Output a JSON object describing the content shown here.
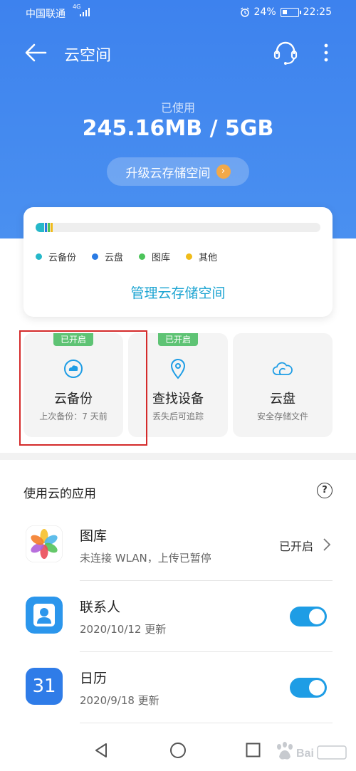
{
  "status_bar": {
    "carrier": "中国联通",
    "network": "4G",
    "battery": "24%",
    "time": "22:25"
  },
  "app_bar": {
    "title": "云空间"
  },
  "storage": {
    "used_label": "已使用",
    "used_value": "245.16MB / 5GB",
    "upgrade_label": "升级云存储空间",
    "usage_segments": [
      {
        "name": "云备份",
        "fraction": 0.03,
        "color": "#26b8c9"
      },
      {
        "name": "云盘",
        "fraction": 0.005,
        "color": "#2a7be4"
      },
      {
        "name": "图库",
        "fraction": 0.004,
        "color": "#4cc45a"
      },
      {
        "name": "其他",
        "fraction": 0.004,
        "color": "#f0bc1a"
      }
    ],
    "legend": [
      {
        "label": "云备份",
        "color": "#26b8c9"
      },
      {
        "label": "云盘",
        "color": "#2a7be4"
      },
      {
        "label": "图库",
        "color": "#4cc45a"
      },
      {
        "label": "其他",
        "color": "#f0bc1a"
      }
    ],
    "manage_label": "管理云存储空间"
  },
  "features": [
    {
      "badge": "",
      "title": "云备份",
      "subtitle": "上次备份：7 天前",
      "icon": "cloud-backup-icon"
    },
    {
      "badge": "已开启",
      "title": "查找设备",
      "subtitle": "丢失后可追踪",
      "icon": "location-pin-icon"
    },
    {
      "badge": "",
      "title": "云盘",
      "subtitle": "安全存储文件",
      "icon": "cloud-drive-icon"
    }
  ],
  "feature_badge_first": "已开启",
  "apps_section": {
    "title": "使用云的应用",
    "items": [
      {
        "name": "图库",
        "subtitle": "未连接 WLAN，上传已暂停",
        "status": "已开启",
        "control": "chevron"
      },
      {
        "name": "联系人",
        "subtitle": "2020/10/12 更新",
        "status": "",
        "control": "toggle",
        "enabled": true
      },
      {
        "name": "日历",
        "subtitle": "2020/9/18 更新",
        "status": "",
        "control": "toggle",
        "enabled": true,
        "icon_text": "31"
      }
    ]
  },
  "colors": {
    "accent": "#3d82ee",
    "link": "#1aa3d1",
    "badge": "#5ec374",
    "toggle": "#1e9de5",
    "highlight": "#d42a2a"
  }
}
